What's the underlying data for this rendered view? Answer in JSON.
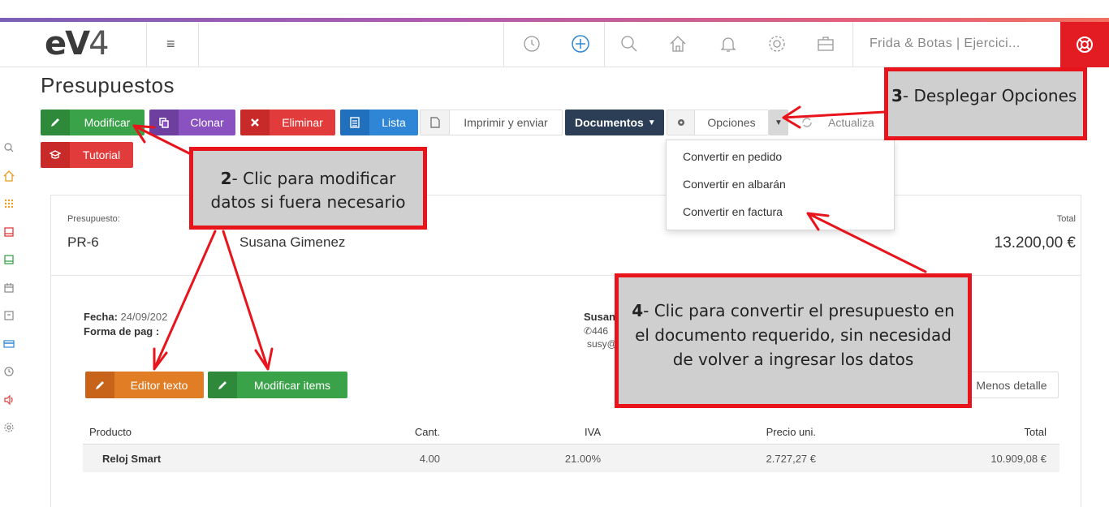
{
  "header": {
    "logo_text": "eV",
    "logo_digit": "4",
    "company": "Frida & Botas | Ejercici...",
    "accent_color": "#e31b23",
    "icons": [
      "menu-icon",
      "history-icon",
      "add-icon",
      "search-icon",
      "home-icon",
      "bell-icon",
      "settings-icon",
      "briefcase-icon",
      "lifebuoy-icon"
    ]
  },
  "page": {
    "title": "Presupuestos"
  },
  "toolbar": {
    "modify": "Modificar",
    "clone": "Clonar",
    "delete": "Eliminar",
    "list": "Lista",
    "print": "Imprimir y enviar",
    "documents": "Documentos",
    "options": "Opciones",
    "refresh": "Actualiza",
    "tutorial": "Tutorial"
  },
  "options_menu": {
    "items": [
      "Convertir en pedido",
      "Convertir en albarán",
      "Convertir en factura"
    ]
  },
  "quote": {
    "label": "Presupuesto:",
    "number": "PR-6",
    "client": "Susana Gimenez",
    "total_label": "Total",
    "total": "13.200,00 €",
    "date_label": "Fecha:",
    "date_value": "24/09/202",
    "payment_label": "Forma de pag",
    "payment_colon": ":",
    "contact_name": "Susan",
    "contact_phone": "446",
    "contact_email": "susy@",
    "text_editor_button": "Editor texto",
    "modify_items_button": "Modificar items",
    "less_detail_button": "Menos detalle"
  },
  "table": {
    "headers": [
      "Producto",
      "Cant.",
      "IVA",
      "Precio uni.",
      "Total"
    ],
    "rows": [
      [
        "Reloj Smart",
        "4.00",
        "21.00%",
        "2.727,27 €",
        "10.909,08 €"
      ]
    ]
  },
  "callouts": {
    "c2_num": "2",
    "c2_line1": "- Clic para modificar",
    "c2_line2": "datos  si fuera necesario",
    "c3_num": "3",
    "c3_text": "- Desplegar Opciones",
    "c4_num": "4",
    "c4_line1": "- Clic para convertir el presupuesto en",
    "c4_line2": "el documento requerido, sin necesidad",
    "c4_line3": "de volver a ingresar los datos"
  }
}
